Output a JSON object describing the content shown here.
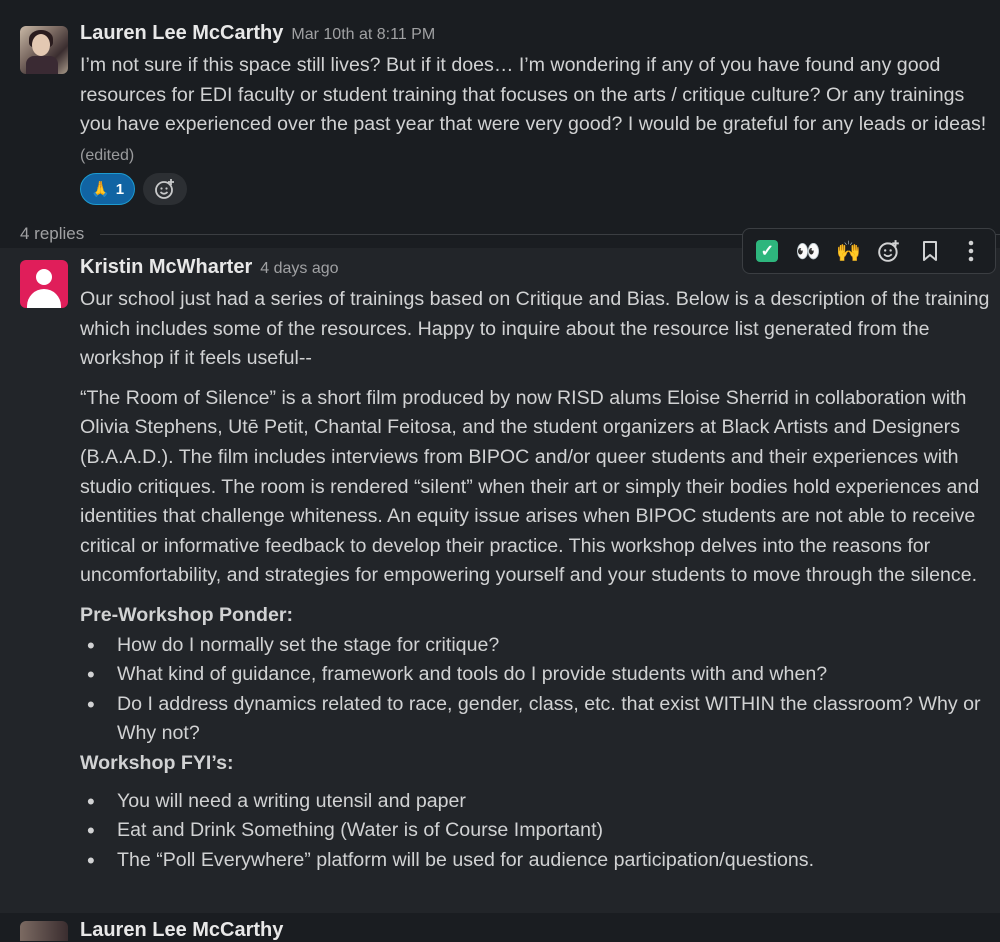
{
  "message1": {
    "author": "Lauren Lee McCarthy",
    "timestamp": "Mar 10th at 8:11 PM",
    "text": "I’m not sure if this space still lives? But if it does… I’m wondering if any of you have found any good resources for EDI faculty or student training that focuses on the arts / critique culture? Or any trainings you have experienced over the past year that were very good? I would be grateful for any leads or ideas!",
    "edited_label": "(edited)",
    "reaction": {
      "emoji": "🙏",
      "count": "1"
    }
  },
  "thread": {
    "replies_label": "4 replies"
  },
  "toolbar": {
    "check_emoji": "✓",
    "eyes_emoji": "👀",
    "hands_emoji": "🙌"
  },
  "message2": {
    "author": "Kristin McWharter",
    "timestamp": "4 days ago",
    "paragraph1": "Our school just had a series of trainings based on Critique and Bias. Below is a description of the training which includes some of the resources. Happy to inquire about the resource list generated from the workshop if it feels useful--",
    "paragraph2": "“The Room of Silence” is a short film produced by now RISD alums Eloise Sherrid in collaboration with Olivia Stephens, Utē Petit, Chantal Feitosa, and the student organizers at Black Artists and Designers (B.A.A.D.). The film includes interviews from BIPOC and/or queer students and their experiences with studio critiques. The room is rendered “silent” when their art or simply their bodies hold experiences and identities that challenge whiteness. An equity issue arises when BIPOC students are not able to receive critical or informative feedback to develop their practice. This workshop delves into the reasons for uncomfortability, and strategies for empowering yourself and your students to move through the silence.",
    "ponder_heading": "Pre-Workshop Ponder:",
    "ponder_items": [
      "How do I normally set the stage for critique?",
      "What kind of guidance, framework and tools do I provide students with and when?",
      "Do I address dynamics related to race, gender, class, etc. that exist WITHIN the classroom? Why or Why not?"
    ],
    "fyi_heading": "Workshop FYI’s:",
    "fyi_items": [
      "You will need a writing utensil and paper",
      "Eat and Drink Something (Water is of Course Important)",
      "The “Poll Everywhere” platform will be used for audience participation/questions."
    ]
  },
  "message3": {
    "author": "Lauren Lee McCarthy"
  },
  "colors": {
    "background": "#1a1d21",
    "highlight_background": "#222529",
    "reaction_active": "#1164a3",
    "avatar_pink": "#e01e5a",
    "check_green": "#2eb67d"
  }
}
